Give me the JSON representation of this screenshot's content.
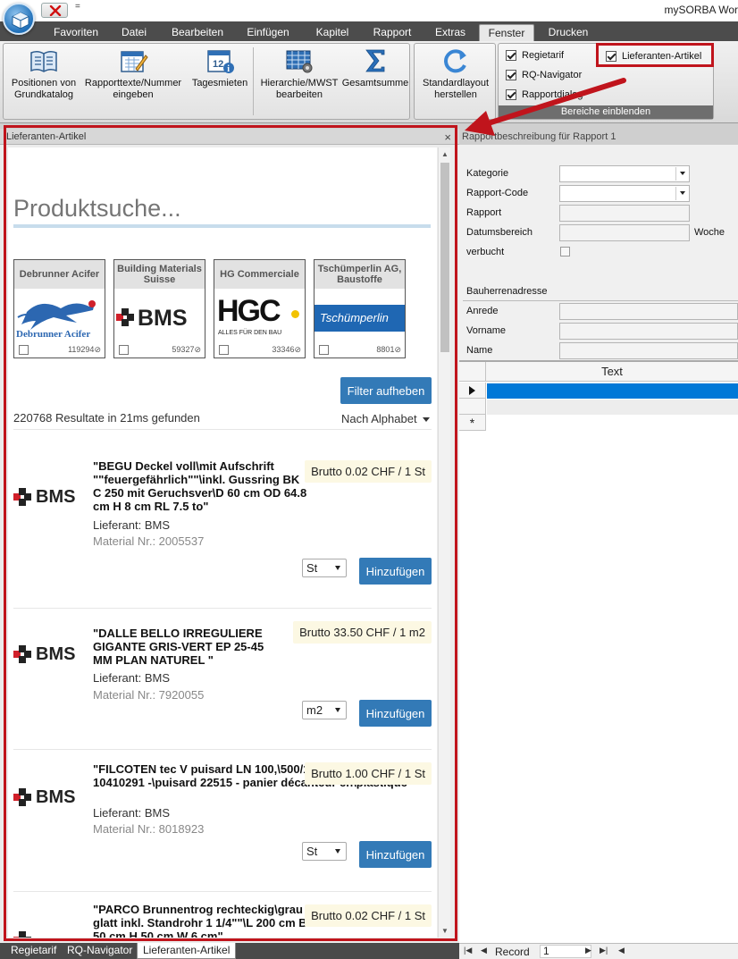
{
  "window": {
    "title": "mySORBA Wor"
  },
  "qat": {
    "dropdown_symbol": "="
  },
  "menu": {
    "tabs": [
      "Favoriten",
      "Datei",
      "Bearbeiten",
      "Einfügen",
      "Kapitel",
      "Rapport",
      "Extras",
      "Fenster",
      "Drucken"
    ],
    "active": "Fenster"
  },
  "ribbon": {
    "buttons": [
      {
        "label": "Positionen von\nGrundkatalog",
        "icon": "book-icon"
      },
      {
        "label": "Rapporttexte/Nummer\neingeben",
        "icon": "calendar-edit-icon"
      },
      {
        "label": "Tagesmieten",
        "icon": "calendar-12-info-icon"
      },
      {
        "label": "Hierarchie/MWST\nbearbeiten",
        "icon": "table-gear-icon"
      },
      {
        "label": "Gesamtsumme",
        "icon": "sigma-icon"
      },
      {
        "label": "Standardlayout\nherstellen",
        "icon": "refresh-icon"
      }
    ],
    "checkboxes": [
      {
        "label": "Regietarif",
        "checked": true
      },
      {
        "label": "RQ-Navigator",
        "checked": true
      },
      {
        "label": "Rapportdialog",
        "checked": true
      },
      {
        "label": "Lieferanten-Artikel",
        "checked": true
      }
    ],
    "group_caption": "Bereiche einblenden"
  },
  "left_panel": {
    "title": "Lieferanten-Artikel",
    "search_placeholder": "Produktsuche...",
    "suppliers": [
      {
        "name": "Debrunner Acifer",
        "count": "119294",
        "logo_text": "Debrunner Acifer"
      },
      {
        "name": "Building Materials Suisse",
        "count": "59327",
        "logo_text": "BMS"
      },
      {
        "name": "HG Commerciale",
        "count": "33346",
        "logo_text": "HGC",
        "logo_sub": "ALLES FÜR DEN BAU"
      },
      {
        "name": "Tschümperlin AG, Baustoffe",
        "count": "8801",
        "logo_text": "Tschümperlin"
      }
    ],
    "filter_button": "Filter aufheben",
    "results_text": "220768 Resultate in 21ms gefunden",
    "sort_label": "Nach Alphabet",
    "add_label": "Hinzufügen",
    "products": [
      {
        "title": "\"BEGU Deckel voll\\mit Aufschrift \"\"feuergefährlich\"\"\\inkl. Gussring BK C 250 mit Geruchsver\\D 60 cm OD 64.8 cm H 8 cm RL 7.5 to\"",
        "price": "Brutto 0.02 CHF / 1 St",
        "supplier": "Lieferant: BMS",
        "material": "Material Nr.: 2005537",
        "unit": "St"
      },
      {
        "title": "\"DALLE BELLO IRREGULIERE GIGANTE GRIS-VERT EP 25-45 MM PLAN NATUREL \"",
        "price": "Brutto 33.50 CHF / 1 m2",
        "supplier": "Lieferant: BMS",
        "material": "Material Nr.: 7920055",
        "unit": "m2"
      },
      {
        "title": "\"FILCOTEN tec V puisard LN 100,\\500/144/500, comprenant: 10410291 -\\puisard 22515 - panier décanteur en\\plastique\"",
        "price": "Brutto 1.00 CHF / 1 St",
        "supplier": "Lieferant: BMS",
        "material": "Material Nr.: 8018923",
        "unit": "St"
      },
      {
        "title": "\"PARCO Brunnentrog rechteckig\\grau glatt inkl. Standrohr 1 1/4\"\"\\L 200 cm B 50 cm H 50 cm W 6 cm\"",
        "price": "Brutto 0.02 CHF / 1 St",
        "supplier": "",
        "material": "",
        "unit": "St"
      }
    ]
  },
  "right_panel": {
    "title": "Rapportbeschreibung für Rapport 1",
    "fields": [
      "Kategorie",
      "Rapport-Code",
      "Rapport",
      "Datumsbereich",
      "verbucht"
    ],
    "woche_label": "Woche",
    "address_heading": "Bauherrenadresse",
    "address_fields": [
      "Anrede",
      "Vorname",
      "Name"
    ],
    "grid_column": "Text",
    "new_row_symbol": "*"
  },
  "bottom_tabs": [
    "Regietarif",
    "RQ-Navigator",
    "Lieferanten-Artikel"
  ],
  "bottom_active": "Lieferanten-Artikel",
  "record_nav": {
    "label": "Record",
    "value": "1"
  },
  "colors": {
    "highlight": "#c0141c",
    "accent_blue": "#337ab7",
    "menubar": "#4c4c4c",
    "price_bg": "#fcf8e3"
  }
}
